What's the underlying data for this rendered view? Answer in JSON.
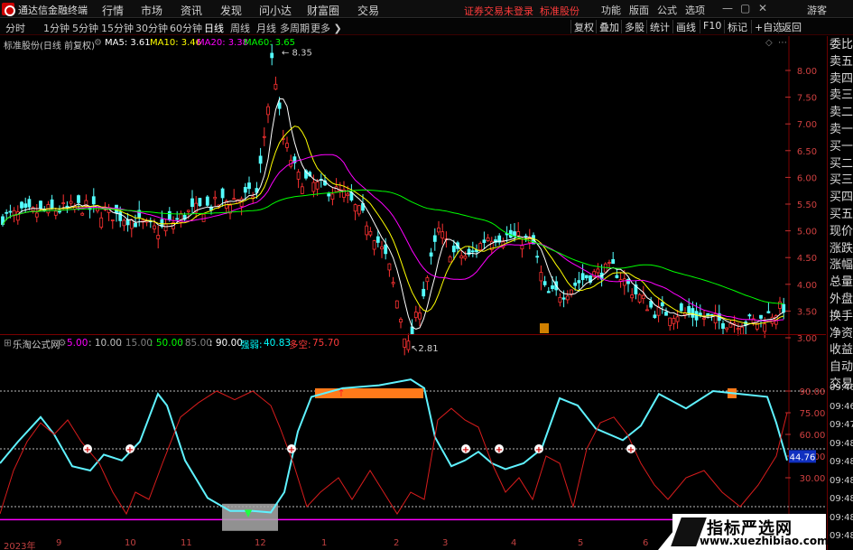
{
  "app": {
    "name": "通达信金融终端",
    "warning": "证券交易未登录",
    "stock_short": "标准股份"
  },
  "menu": [
    "行情",
    "市场",
    "资讯",
    "发现",
    "问小达",
    "财富圈",
    "交易"
  ],
  "right_menu": [
    "功能",
    "版面",
    "公式",
    "选项",
    "画线",
    "游客"
  ],
  "periods": [
    "分时",
    "1分钟",
    "5分钟",
    "15分钟",
    "30分钟",
    "60分钟",
    "日线",
    "周线",
    "月线",
    "多周期",
    "更多"
  ],
  "active_period": "日线",
  "toolbar": [
    "复权",
    "叠加",
    "多股",
    "统计",
    "画线",
    "F10",
    "标记",
    "+自选",
    "返回"
  ],
  "info": {
    "stock": "标准股份(日线 前复权)",
    "ma": [
      {
        "label": "MA5: 3.61",
        "color": "#ffffff"
      },
      {
        "label": "MA10: 3.46",
        "color": "#ffff00"
      },
      {
        "label": "MA20: 3.38",
        "color": "#ff00ff"
      },
      {
        "label": "MA60: 3.65",
        "color": "#00ff00"
      }
    ]
  },
  "price_axis": [
    "8.00",
    "7.50",
    "7.00",
    "6.50",
    "6.00",
    "5.50",
    "5.00",
    "4.50",
    "4.00",
    "3.50",
    "3.00"
  ],
  "price_labels": {
    "high": "8.35",
    "low": "2.81"
  },
  "indicator": {
    "name": "乐淘公式网",
    "params": [
      {
        "label": "5.00",
        "color": "#ff00ff"
      },
      {
        "label": ": 10.00",
        "color": "#c0c0c0"
      },
      {
        "label": ": 15.00",
        "color": "#808080"
      },
      {
        "label": ": 50.00",
        "color": "#00ff00"
      },
      {
        "label": ": 85.00",
        "color": "#808080"
      },
      {
        "label": ": 90.00",
        "color": "#ffffff"
      }
    ],
    "strong": {
      "label": "强弱:",
      "value": "40.83"
    },
    "multi": {
      "label": "多空:",
      "value": "75.70"
    },
    "axis": [
      "90.00",
      "75.00",
      "60.00",
      "45.00",
      "30.00"
    ],
    "current": "44.76"
  },
  "right_panel": [
    "委比",
    "卖五",
    "卖四",
    "卖三",
    "卖二",
    "卖一",
    "买一",
    "买二",
    "买三",
    "买四",
    "买五",
    "现价",
    "涨跌",
    "涨幅",
    "总量",
    "外盘",
    "换手",
    "净资",
    "收益",
    "自动",
    "交易"
  ],
  "right_times": [
    "09:46",
    "09:46",
    "09:47",
    "09:48",
    "09:48",
    "09:48",
    "09:48",
    "09:48",
    "09:48"
  ],
  "date_axis": [
    "2023年",
    "9",
    "10",
    "11",
    "12",
    "1",
    "2",
    "3",
    "4",
    "5",
    "6"
  ],
  "watermark": {
    "title": "指标严选网",
    "url": "www.xuezhibiao.com"
  },
  "chart_data": {
    "type": "candlestick",
    "series": [
      {
        "name": "MA5",
        "value": 3.61
      },
      {
        "name": "MA10",
        "value": 3.46
      },
      {
        "name": "MA20",
        "value": 3.38
      },
      {
        "name": "MA60",
        "value": 3.65
      }
    ],
    "ylim": [
      2.8,
      8.5
    ],
    "high": 8.35,
    "low": 2.81,
    "indicator": {
      "strong": 40.83,
      "multi": 75.7,
      "ylim": [
        0,
        100
      ],
      "levels": [
        90,
        50,
        10
      ]
    }
  }
}
